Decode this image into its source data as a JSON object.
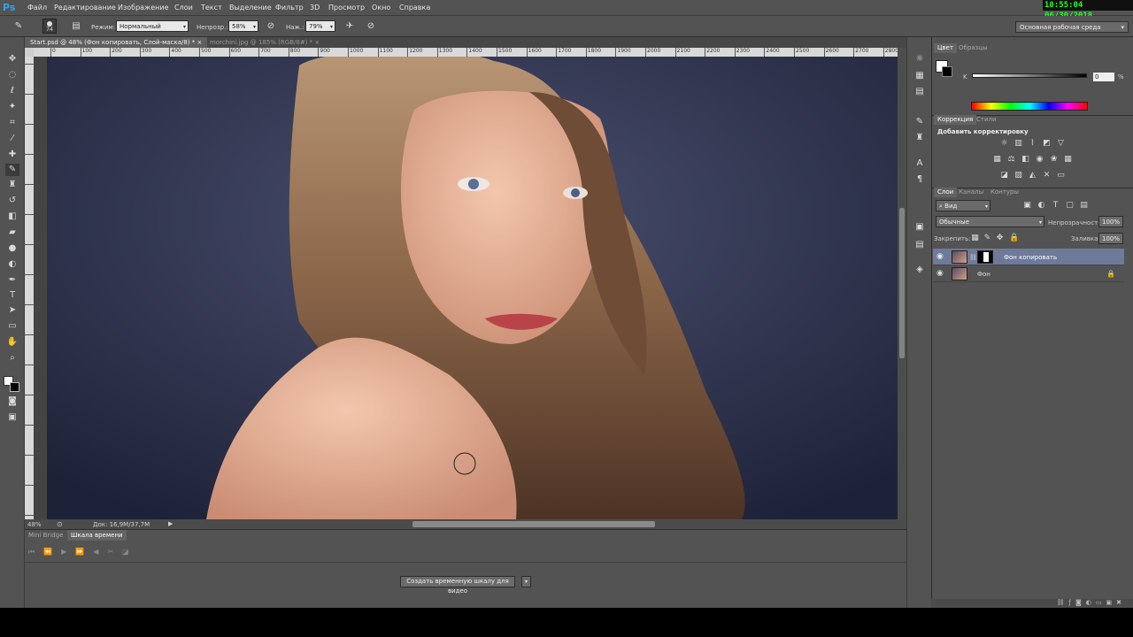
{
  "app": {
    "logo": "Ps",
    "clock": "10:55:04  06/30/2018"
  },
  "menu": [
    "Файл",
    "Редактирование",
    "Изображение",
    "Слои",
    "Текст",
    "Выделение",
    "Фильтр",
    "3D",
    "Просмотр",
    "Окно",
    "Справка"
  ],
  "options": {
    "brush_size": "74",
    "mode_label": "Режим:",
    "mode_value": "Нормальный",
    "opacity_label": "Непрозр.:",
    "opacity_value": "58%",
    "pressure_label": "Наж.:",
    "pressure_value": "79%",
    "workspace": "Основная рабочая среда"
  },
  "tabs": [
    {
      "label": "Start.psd @ 48% (Фон копировать, Слой-маска/8) *",
      "active": true
    },
    {
      "label": "morchini.jpg @ 185% (RGB/8#) *",
      "active": false
    }
  ],
  "ruler_h": [
    "0",
    "100",
    "200",
    "300",
    "400",
    "500",
    "600",
    "700",
    "800",
    "900",
    "1000",
    "1100",
    "1200",
    "1300",
    "1400",
    "1500",
    "1600",
    "1700",
    "1800",
    "1900",
    "2000",
    "2100",
    "2200",
    "2300",
    "2400",
    "2500",
    "2600",
    "2700",
    "2800",
    "2900"
  ],
  "status": {
    "zoom": "48%",
    "doc": "Док: 16,9M/37,7M"
  },
  "timeline": {
    "tabs": [
      "Mini Bridge",
      "Шкала времени"
    ],
    "create_button": "Создать временную шкалу для видео"
  },
  "color_panel": {
    "tabs": [
      "Цвет",
      "Образцы"
    ],
    "k_label": "K",
    "k_value": "0",
    "unit": "%"
  },
  "adjust_panel": {
    "tabs": [
      "Коррекция",
      "Стили"
    ],
    "title": "Добавить корректировку"
  },
  "layers_panel": {
    "tabs": [
      "Слои",
      "Каналы",
      "Контуры"
    ],
    "filter": "Вид",
    "blend": "Обычные",
    "opacity_label": "Непрозрачность:",
    "opacity_value": "100%",
    "lock_label": "Закрепить:",
    "fill_label": "Заливка:",
    "fill_value": "100%",
    "layers": [
      {
        "name": "Фон копировать",
        "selected": true,
        "mask": true
      },
      {
        "name": "Фон",
        "selected": false,
        "locked": true
      }
    ]
  }
}
